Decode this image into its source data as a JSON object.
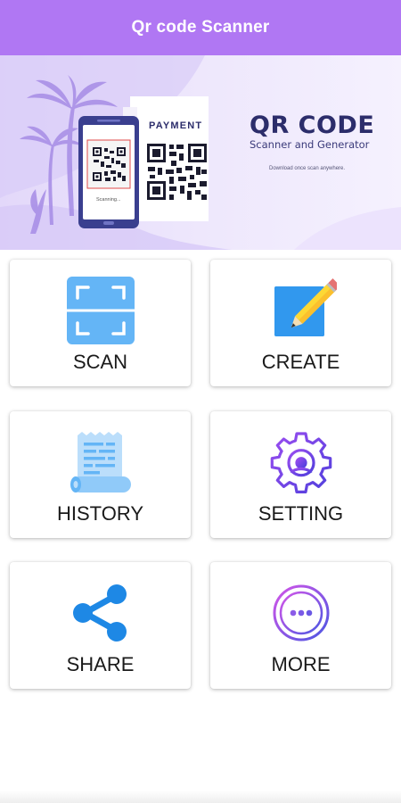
{
  "appbar": {
    "title": "Qr code Scanner",
    "color": "#b077f3"
  },
  "banner": {
    "title": "QR CODE",
    "subtitle": "Scanner and Generator",
    "tagline": "Download once scan anywhere.",
    "payment_label": "PAYMENT",
    "scanning_label": "Scanning..."
  },
  "menu": {
    "items": [
      {
        "label": "SCAN",
        "icon": "scan-icon"
      },
      {
        "label": "CREATE",
        "icon": "edit-pencil-icon"
      },
      {
        "label": "HISTORY",
        "icon": "receipt-history-icon"
      },
      {
        "label": "SETTING",
        "icon": "gear-icon"
      },
      {
        "label": "SHARE",
        "icon": "share-icon"
      },
      {
        "label": "MORE",
        "icon": "more-dots-icon"
      }
    ]
  }
}
